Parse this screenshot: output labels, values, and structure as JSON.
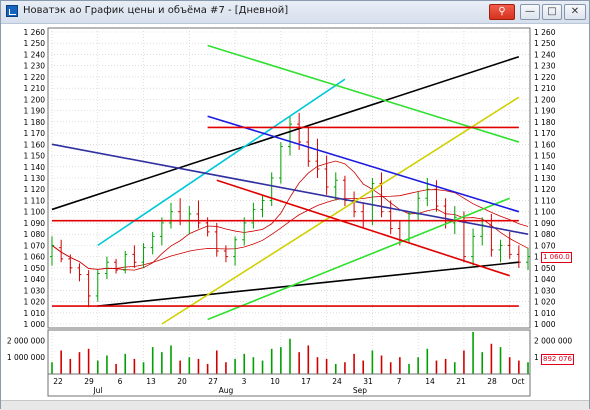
{
  "window": {
    "title": "Новатэк ао График цены и объёма #7 - [Дневной]",
    "buttons": [
      "⚲",
      "—",
      "□",
      "✕"
    ]
  },
  "chart_data": [
    {
      "type": "candlestick",
      "panel": "price",
      "x_dates": [
        "2024-07-22",
        "2024-07-23",
        "2024-07-24",
        "2024-07-25",
        "2024-07-26",
        "2024-07-29",
        "2024-07-30",
        "2024-07-31",
        "2024-08-01",
        "2024-08-02",
        "2024-08-05",
        "2024-08-06",
        "2024-08-07",
        "2024-08-08",
        "2024-08-09",
        "2024-08-12",
        "2024-08-13",
        "2024-08-14",
        "2024-08-15",
        "2024-08-16",
        "2024-08-19",
        "2024-08-20",
        "2024-08-21",
        "2024-08-22",
        "2024-08-23",
        "2024-08-26",
        "2024-08-27",
        "2024-08-28",
        "2024-08-29",
        "2024-08-30",
        "2024-09-02",
        "2024-09-03",
        "2024-09-04",
        "2024-09-05",
        "2024-09-06",
        "2024-09-09",
        "2024-09-10",
        "2024-09-11",
        "2024-09-12",
        "2024-09-13",
        "2024-09-16",
        "2024-09-17",
        "2024-09-18",
        "2024-09-19",
        "2024-09-20",
        "2024-09-23",
        "2024-09-24",
        "2024-09-25",
        "2024-09-26",
        "2024-09-27",
        "2024-09-30",
        "2024-10-01",
        "2024-10-02"
      ],
      "ohlc": [
        [
          1060,
          1078,
          1052,
          1070
        ],
        [
          1068,
          1075,
          1055,
          1058
        ],
        [
          1058,
          1062,
          1045,
          1050
        ],
        [
          1050,
          1054,
          1038,
          1044
        ],
        [
          1044,
          1048,
          1015,
          1025
        ],
        [
          1025,
          1048,
          1020,
          1045
        ],
        [
          1045,
          1060,
          1040,
          1055
        ],
        [
          1055,
          1058,
          1045,
          1048
        ],
        [
          1048,
          1065,
          1045,
          1062
        ],
        [
          1062,
          1070,
          1050,
          1055
        ],
        [
          1055,
          1072,
          1050,
          1068
        ],
        [
          1068,
          1082,
          1062,
          1078
        ],
        [
          1078,
          1095,
          1070,
          1090
        ],
        [
          1090,
          1108,
          1085,
          1100
        ],
        [
          1100,
          1112,
          1088,
          1092
        ],
        [
          1092,
          1105,
          1080,
          1098
        ],
        [
          1098,
          1110,
          1085,
          1090
        ],
        [
          1090,
          1095,
          1078,
          1082
        ],
        [
          1082,
          1090,
          1060,
          1065
        ],
        [
          1065,
          1070,
          1055,
          1060
        ],
        [
          1060,
          1078,
          1052,
          1075
        ],
        [
          1075,
          1095,
          1070,
          1090
        ],
        [
          1090,
          1108,
          1085,
          1102
        ],
        [
          1102,
          1115,
          1095,
          1110
        ],
        [
          1110,
          1135,
          1105,
          1130
        ],
        [
          1130,
          1162,
          1125,
          1158
        ],
        [
          1158,
          1185,
          1150,
          1178
        ],
        [
          1178,
          1188,
          1155,
          1162
        ],
        [
          1162,
          1175,
          1140,
          1145
        ],
        [
          1145,
          1165,
          1130,
          1138
        ],
        [
          1138,
          1150,
          1115,
          1122
        ],
        [
          1122,
          1135,
          1110,
          1128
        ],
        [
          1128,
          1132,
          1105,
          1110
        ],
        [
          1110,
          1118,
          1095,
          1100
        ],
        [
          1100,
          1108,
          1085,
          1092
        ],
        [
          1092,
          1130,
          1088,
          1125
        ],
        [
          1125,
          1135,
          1095,
          1100
        ],
        [
          1100,
          1110,
          1080,
          1085
        ],
        [
          1085,
          1092,
          1070,
          1075
        ],
        [
          1075,
          1100,
          1072,
          1098
        ],
        [
          1098,
          1118,
          1092,
          1112
        ],
        [
          1112,
          1130,
          1105,
          1120
        ],
        [
          1120,
          1128,
          1100,
          1105
        ],
        [
          1105,
          1112,
          1085,
          1090
        ],
        [
          1090,
          1105,
          1080,
          1095
        ],
        [
          1095,
          1100,
          1055,
          1060
        ],
        [
          1060,
          1085,
          1052,
          1078
        ],
        [
          1078,
          1095,
          1070,
          1088
        ],
        [
          1088,
          1098,
          1060,
          1066
        ],
        [
          1066,
          1075,
          1055,
          1070
        ],
        [
          1070,
          1082,
          1058,
          1062
        ],
        [
          1062,
          1070,
          1050,
          1055
        ],
        [
          1055,
          1068,
          1048,
          1060
        ]
      ],
      "moving_averages": [
        {
          "name": "MA20",
          "color": "#cc0000"
        },
        {
          "name": "MA50",
          "color": "#cc0000"
        }
      ],
      "y_axis": {
        "min": 1000,
        "max": 1260,
        "step": 10,
        "tick_labels": [
          "1 000",
          "1 010",
          "1 020",
          "1 030",
          "1 040",
          "1 050",
          "1 060",
          "1 070",
          "1 080",
          "1 090",
          "1 100",
          "1 110",
          "1 120",
          "1 130",
          "1 140",
          "1 150",
          "1 160",
          "1 170",
          "1 180",
          "1 190",
          "1 200",
          "1 210",
          "1 220",
          "1 230",
          "1 240",
          "1 250",
          "1 260"
        ]
      },
      "last_price_label": "1 060.0"
    },
    {
      "type": "bar",
      "panel": "volume",
      "y_axis": {
        "tick_labels": [
          "1 000 000",
          "2 000 000"
        ]
      },
      "values": [
        700000,
        1400000,
        900000,
        1300000,
        1500000,
        800000,
        1100000,
        600000,
        1200000,
        900000,
        700000,
        1600000,
        1300000,
        1700000,
        800000,
        1000000,
        900000,
        600000,
        1400000,
        700000,
        900000,
        1200000,
        1000000,
        800000,
        1500000,
        1600000,
        2100000,
        1300000,
        1700000,
        1000000,
        900000,
        600000,
        700000,
        1200000,
        800000,
        1400000,
        1100000,
        700000,
        1000000,
        600000,
        1000000,
        1500000,
        800000,
        900000,
        700000,
        1400000,
        2500000,
        1300000,
        1800000,
        1600000,
        1000000,
        800000,
        700000
      ],
      "last_volume_label": "892 076"
    }
  ],
  "x_axis": {
    "day_labels": [
      "22",
      "29",
      "6",
      "13",
      "20",
      "27",
      "3",
      "10",
      "17",
      "24",
      "31",
      "7",
      "14",
      "21",
      "28",
      "Oct"
    ],
    "month_labels": [
      "Jul",
      "Aug",
      "Sep"
    ]
  },
  "trend_lines": [
    {
      "name": "black-channel-top",
      "color": "#000000",
      "from": [
        "2024-07-22",
        1102
      ],
      "to": [
        "2024-10-01",
        1238
      ]
    },
    {
      "name": "black-channel-bottom",
      "color": "#000000",
      "from": [
        "2024-07-29",
        1016
      ],
      "to": [
        "2024-10-01",
        1055
      ]
    },
    {
      "name": "cyan-line",
      "color": "#00c8d8",
      "from": [
        "2024-07-29",
        1070
      ],
      "to": [
        "2024-09-04",
        1218
      ]
    },
    {
      "name": "navy-line",
      "color": "#3030a0",
      "from": [
        "2024-07-22",
        1160
      ],
      "to": [
        "2024-10-02",
        1080
      ]
    },
    {
      "name": "yellow-line",
      "color": "#d0d000",
      "from": [
        "2024-08-07",
        1000
      ],
      "to": [
        "2024-10-01",
        1202
      ]
    },
    {
      "name": "green-line-down",
      "color": "#30e030",
      "from": [
        "2024-08-14",
        1248
      ],
      "to": [
        "2024-10-01",
        1162
      ]
    },
    {
      "name": "green-line-up",
      "color": "#30e030",
      "from": [
        "2024-08-14",
        1004
      ],
      "to": [
        "2024-09-30",
        1112
      ]
    },
    {
      "name": "blue-line",
      "color": "#1a1ae0",
      "from": [
        "2024-08-14",
        1185
      ],
      "to": [
        "2024-10-01",
        1100
      ]
    },
    {
      "name": "red-diagonal",
      "color": "#e00000",
      "from": [
        "2024-08-15",
        1128
      ],
      "to": [
        "2024-09-30",
        1043
      ]
    },
    {
      "name": "red-horizontal-high",
      "color": "#e00000",
      "from": [
        "2024-08-14",
        1175
      ],
      "to": [
        "2024-10-01",
        1175
      ]
    },
    {
      "name": "red-horizontal-mid",
      "color": "#e00000",
      "from": [
        "2024-07-22",
        1092
      ],
      "to": [
        "2024-10-01",
        1092
      ]
    },
    {
      "name": "red-horizontal-low",
      "color": "#e00000",
      "from": [
        "2024-07-22",
        1016
      ],
      "to": [
        "2024-10-01",
        1016
      ]
    }
  ],
  "colors": {
    "up": "#00a000",
    "down": "#d00000",
    "grid": "#c8c8c8",
    "text": "#000000"
  }
}
